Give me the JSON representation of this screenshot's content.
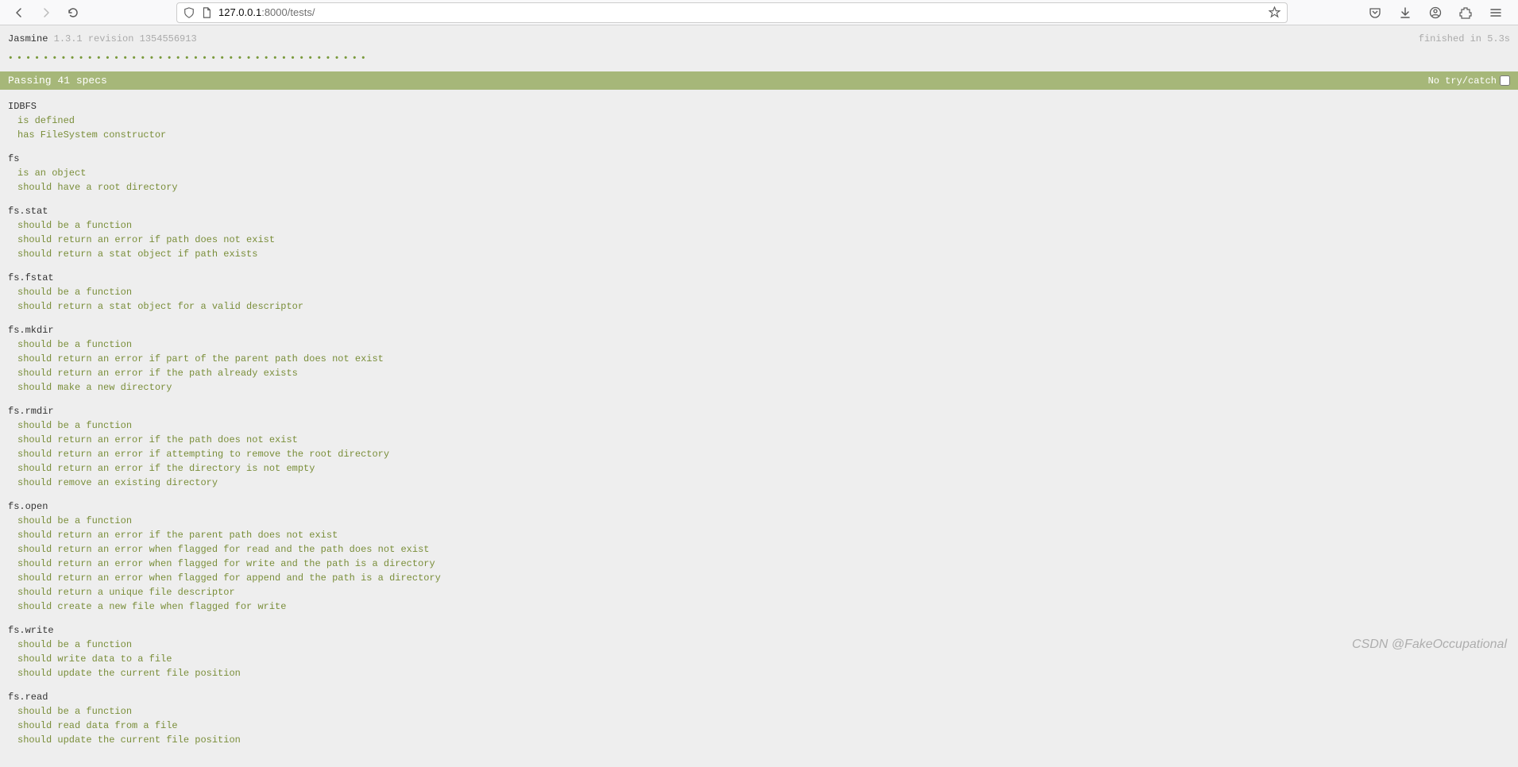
{
  "browser": {
    "url_host": "127.0.0.1",
    "url_path": ":8000/tests/"
  },
  "header": {
    "name": "Jasmine",
    "version": "1.3.1 revision 1354556913",
    "duration": "finished in 5.3s"
  },
  "dot_count": 41,
  "summary": {
    "text": "Passing 41 specs",
    "trycatch_label": "No try/catch"
  },
  "suites": [
    {
      "name": "IDBFS",
      "specs": [
        "is defined",
        "has FileSystem constructor"
      ]
    },
    {
      "name": "fs",
      "specs": [
        "is an object",
        "should have a root directory"
      ]
    },
    {
      "name": "fs.stat",
      "specs": [
        "should be a function",
        "should return an error if path does not exist",
        "should return a stat object if path exists"
      ]
    },
    {
      "name": "fs.fstat",
      "specs": [
        "should be a function",
        "should return a stat object for a valid descriptor"
      ]
    },
    {
      "name": "fs.mkdir",
      "specs": [
        "should be a function",
        "should return an error if part of the parent path does not exist",
        "should return an error if the path already exists",
        "should make a new directory"
      ]
    },
    {
      "name": "fs.rmdir",
      "specs": [
        "should be a function",
        "should return an error if the path does not exist",
        "should return an error if attempting to remove the root directory",
        "should return an error if the directory is not empty",
        "should remove an existing directory"
      ]
    },
    {
      "name": "fs.open",
      "specs": [
        "should be a function",
        "should return an error if the parent path does not exist",
        "should return an error when flagged for read and the path does not exist",
        "should return an error when flagged for write and the path is a directory",
        "should return an error when flagged for append and the path is a directory",
        "should return a unique file descriptor",
        "should create a new file when flagged for write"
      ]
    },
    {
      "name": "fs.write",
      "specs": [
        "should be a function",
        "should write data to a file",
        "should update the current file position"
      ]
    },
    {
      "name": "fs.read",
      "specs": [
        "should be a function",
        "should read data from a file",
        "should update the current file position"
      ]
    }
  ],
  "watermark": "CSDN @FakeOccupational"
}
